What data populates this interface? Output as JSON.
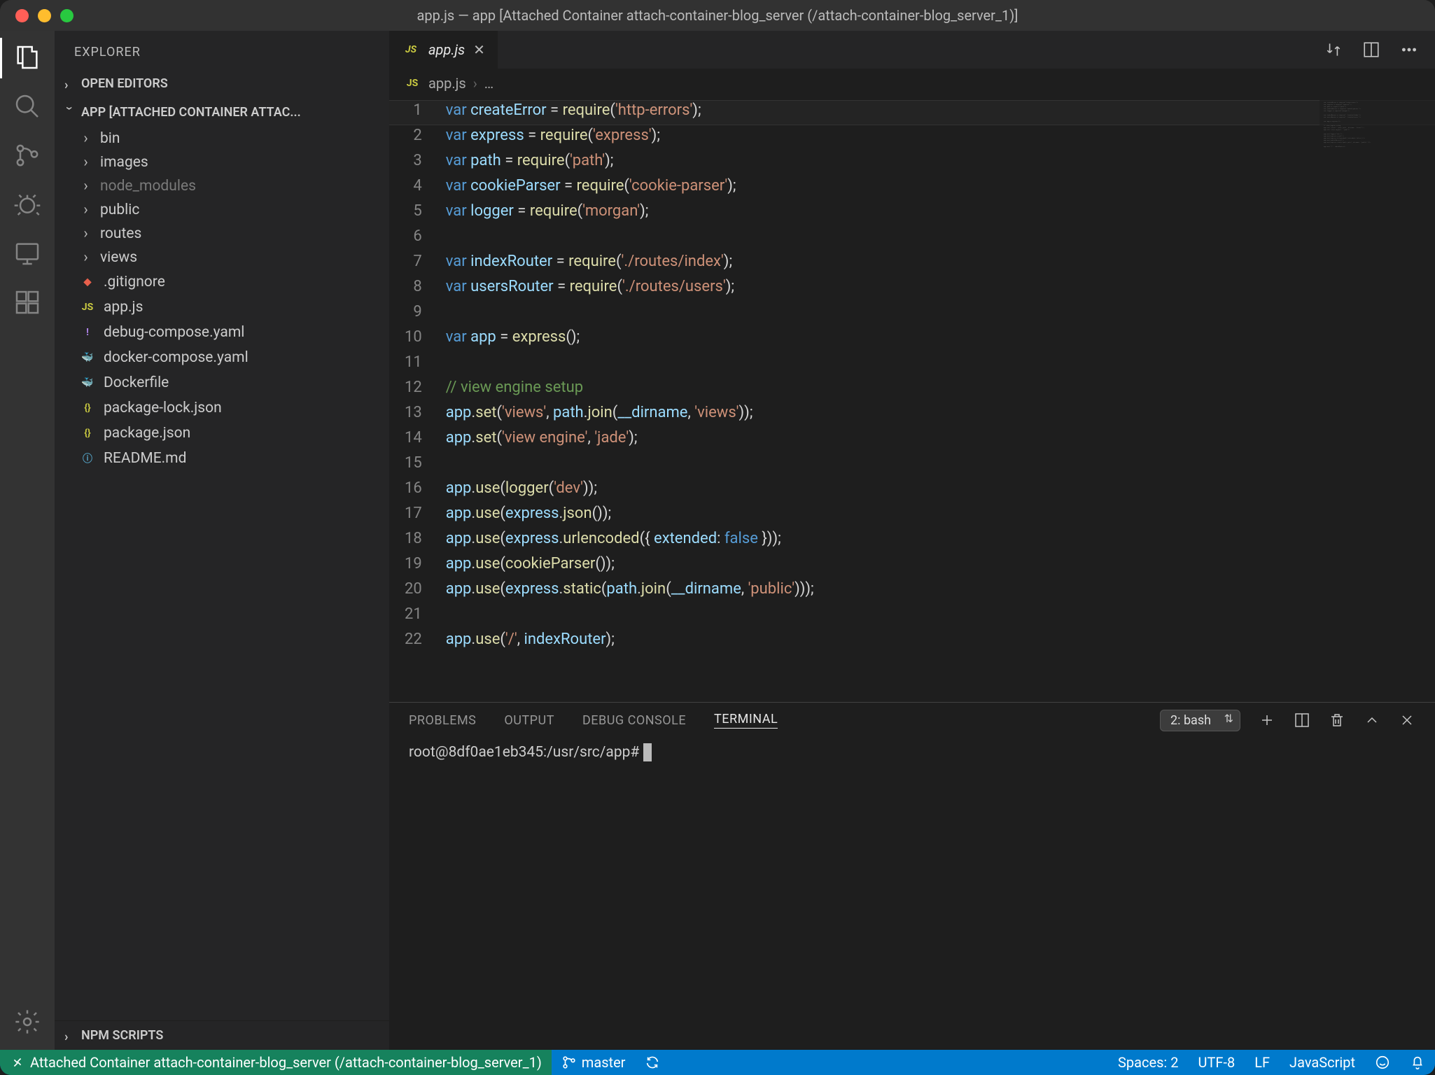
{
  "window": {
    "title": "app.js — app [Attached Container attach-container-blog_server (/attach-container-blog_server_1)]"
  },
  "sidebar": {
    "title": "EXPLORER",
    "sections": {
      "open_editors": "OPEN EDITORS",
      "project": "APP [ATTACHED CONTAINER ATTAC...",
      "npm": "NPM SCRIPTS"
    },
    "tree": [
      {
        "label": "bin",
        "kind": "folder"
      },
      {
        "label": "images",
        "kind": "folder"
      },
      {
        "label": "node_modules",
        "kind": "folder",
        "dim": true
      },
      {
        "label": "public",
        "kind": "folder"
      },
      {
        "label": "routes",
        "kind": "folder"
      },
      {
        "label": "views",
        "kind": "folder"
      },
      {
        "label": ".gitignore",
        "kind": "git"
      },
      {
        "label": "app.js",
        "kind": "js"
      },
      {
        "label": "debug-compose.yaml",
        "kind": "yaml"
      },
      {
        "label": "docker-compose.yaml",
        "kind": "docker"
      },
      {
        "label": "Dockerfile",
        "kind": "docker"
      },
      {
        "label": "package-lock.json",
        "kind": "json"
      },
      {
        "label": "package.json",
        "kind": "json"
      },
      {
        "label": "README.md",
        "kind": "info"
      }
    ]
  },
  "tab": {
    "label": "app.js"
  },
  "breadcrumb": {
    "file": "app.js",
    "more": "…"
  },
  "code_lines": [
    [
      [
        "kw",
        "var "
      ],
      [
        "id",
        "createError"
      ],
      [
        "punc",
        " = "
      ],
      [
        "fn",
        "require"
      ],
      [
        "punc",
        "("
      ],
      [
        "str",
        "'http-errors'"
      ],
      [
        "punc",
        ");"
      ]
    ],
    [
      [
        "kw",
        "var "
      ],
      [
        "id",
        "express"
      ],
      [
        "punc",
        " = "
      ],
      [
        "fn",
        "require"
      ],
      [
        "punc",
        "("
      ],
      [
        "str",
        "'express'"
      ],
      [
        "punc",
        ");"
      ]
    ],
    [
      [
        "kw",
        "var "
      ],
      [
        "id",
        "path"
      ],
      [
        "punc",
        " = "
      ],
      [
        "fn",
        "require"
      ],
      [
        "punc",
        "("
      ],
      [
        "str",
        "'path'"
      ],
      [
        "punc",
        ");"
      ]
    ],
    [
      [
        "kw",
        "var "
      ],
      [
        "id",
        "cookieParser"
      ],
      [
        "punc",
        " = "
      ],
      [
        "fn",
        "require"
      ],
      [
        "punc",
        "("
      ],
      [
        "str",
        "'cookie-parser'"
      ],
      [
        "punc",
        ");"
      ]
    ],
    [
      [
        "kw",
        "var "
      ],
      [
        "id",
        "logger"
      ],
      [
        "punc",
        " = "
      ],
      [
        "fn",
        "require"
      ],
      [
        "punc",
        "("
      ],
      [
        "str",
        "'morgan'"
      ],
      [
        "punc",
        ");"
      ]
    ],
    [],
    [
      [
        "kw",
        "var "
      ],
      [
        "id",
        "indexRouter"
      ],
      [
        "punc",
        " = "
      ],
      [
        "fn",
        "require"
      ],
      [
        "punc",
        "("
      ],
      [
        "str",
        "'./routes/index'"
      ],
      [
        "punc",
        ");"
      ]
    ],
    [
      [
        "kw",
        "var "
      ],
      [
        "id",
        "usersRouter"
      ],
      [
        "punc",
        " = "
      ],
      [
        "fn",
        "require"
      ],
      [
        "punc",
        "("
      ],
      [
        "str",
        "'./routes/users'"
      ],
      [
        "punc",
        ");"
      ]
    ],
    [],
    [
      [
        "kw",
        "var "
      ],
      [
        "id",
        "app"
      ],
      [
        "punc",
        " = "
      ],
      [
        "fn",
        "express"
      ],
      [
        "punc",
        "();"
      ]
    ],
    [],
    [
      [
        "cm",
        "// view engine setup"
      ]
    ],
    [
      [
        "id",
        "app"
      ],
      [
        "punc",
        "."
      ],
      [
        "fn",
        "set"
      ],
      [
        "punc",
        "("
      ],
      [
        "str",
        "'views'"
      ],
      [
        "punc",
        ", "
      ],
      [
        "id",
        "path"
      ],
      [
        "punc",
        "."
      ],
      [
        "fn",
        "join"
      ],
      [
        "punc",
        "("
      ],
      [
        "id",
        "__dirname"
      ],
      [
        "punc",
        ", "
      ],
      [
        "str",
        "'views'"
      ],
      [
        "punc",
        "));"
      ]
    ],
    [
      [
        "id",
        "app"
      ],
      [
        "punc",
        "."
      ],
      [
        "fn",
        "set"
      ],
      [
        "punc",
        "("
      ],
      [
        "str",
        "'view engine'"
      ],
      [
        "punc",
        ", "
      ],
      [
        "str",
        "'jade'"
      ],
      [
        "punc",
        ");"
      ]
    ],
    [],
    [
      [
        "id",
        "app"
      ],
      [
        "punc",
        "."
      ],
      [
        "fn",
        "use"
      ],
      [
        "punc",
        "("
      ],
      [
        "fn",
        "logger"
      ],
      [
        "punc",
        "("
      ],
      [
        "str",
        "'dev'"
      ],
      [
        "punc",
        "));"
      ]
    ],
    [
      [
        "id",
        "app"
      ],
      [
        "punc",
        "."
      ],
      [
        "fn",
        "use"
      ],
      [
        "punc",
        "("
      ],
      [
        "id",
        "express"
      ],
      [
        "punc",
        "."
      ],
      [
        "fn",
        "json"
      ],
      [
        "punc",
        "());"
      ]
    ],
    [
      [
        "id",
        "app"
      ],
      [
        "punc",
        "."
      ],
      [
        "fn",
        "use"
      ],
      [
        "punc",
        "("
      ],
      [
        "id",
        "express"
      ],
      [
        "punc",
        "."
      ],
      [
        "fn",
        "urlencoded"
      ],
      [
        "punc",
        "({ "
      ],
      [
        "id",
        "extended"
      ],
      [
        "punc",
        ": "
      ],
      [
        "lit",
        "false"
      ],
      [
        "punc",
        " }));"
      ]
    ],
    [
      [
        "id",
        "app"
      ],
      [
        "punc",
        "."
      ],
      [
        "fn",
        "use"
      ],
      [
        "punc",
        "("
      ],
      [
        "fn",
        "cookieParser"
      ],
      [
        "punc",
        "());"
      ]
    ],
    [
      [
        "id",
        "app"
      ],
      [
        "punc",
        "."
      ],
      [
        "fn",
        "use"
      ],
      [
        "punc",
        "("
      ],
      [
        "id",
        "express"
      ],
      [
        "punc",
        "."
      ],
      [
        "fn",
        "static"
      ],
      [
        "punc",
        "("
      ],
      [
        "id",
        "path"
      ],
      [
        "punc",
        "."
      ],
      [
        "fn",
        "join"
      ],
      [
        "punc",
        "("
      ],
      [
        "id",
        "__dirname"
      ],
      [
        "punc",
        ", "
      ],
      [
        "str",
        "'public'"
      ],
      [
        "punc",
        ")));"
      ]
    ],
    [],
    [
      [
        "id",
        "app"
      ],
      [
        "punc",
        "."
      ],
      [
        "fn",
        "use"
      ],
      [
        "punc",
        "("
      ],
      [
        "str",
        "'/'"
      ],
      [
        "punc",
        ", "
      ],
      [
        "id",
        "indexRouter"
      ],
      [
        "punc",
        ");"
      ]
    ]
  ],
  "panel": {
    "tabs": {
      "problems": "PROBLEMS",
      "output": "OUTPUT",
      "debug": "DEBUG CONSOLE",
      "terminal": "TERMINAL"
    },
    "select": "2: bash",
    "prompt": "root@8df0ae1eb345:/usr/src/app#"
  },
  "statusbar": {
    "remote": "Attached Container attach-container-blog_server (/attach-container-blog_server_1)",
    "branch": "master",
    "spaces": "Spaces: 2",
    "encoding": "UTF-8",
    "eol": "LF",
    "lang": "JavaScript"
  }
}
